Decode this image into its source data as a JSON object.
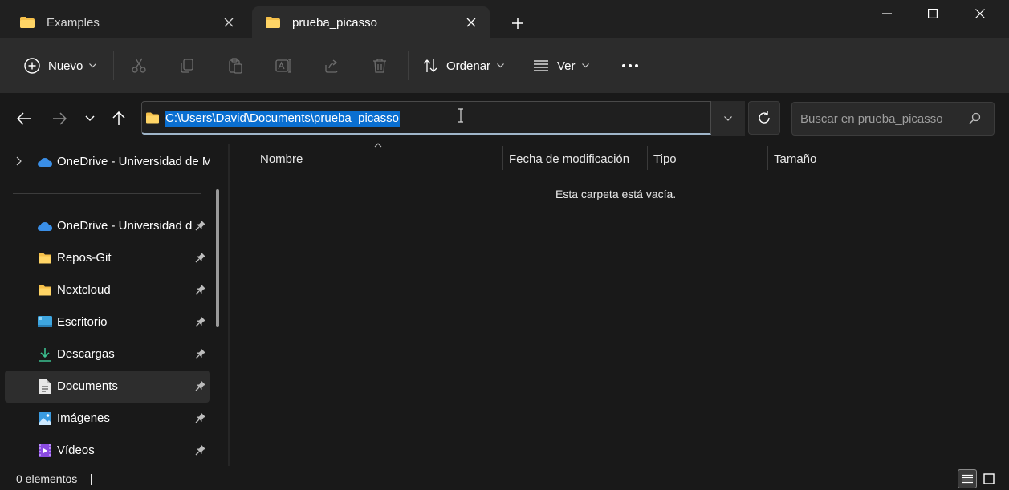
{
  "tabs": [
    {
      "label": "Examples",
      "active": false
    },
    {
      "label": "prueba_picasso",
      "active": true
    }
  ],
  "toolbar": {
    "new_label": "Nuevo",
    "sort_label": "Ordenar",
    "view_label": "Ver"
  },
  "address": {
    "path": "C:\\Users\\David\\Documents\\prueba_picasso"
  },
  "search": {
    "placeholder": "Buscar en prueba_picasso"
  },
  "sidebar": {
    "top_item": "OneDrive - Universidad de M",
    "items": [
      {
        "label": "OneDrive - Universidad de Málaga",
        "icon": "cloud-icon"
      },
      {
        "label": "Repos-Git",
        "icon": "folder-icon"
      },
      {
        "label": "Nextcloud",
        "icon": "folder-icon"
      },
      {
        "label": "Escritorio",
        "icon": "desktop-icon"
      },
      {
        "label": "Descargas",
        "icon": "download-icon"
      },
      {
        "label": "Documents",
        "icon": "document-icon",
        "selected": true
      },
      {
        "label": "Imágenes",
        "icon": "image-icon"
      },
      {
        "label": "Vídeos",
        "icon": "video-icon"
      }
    ]
  },
  "columns": {
    "name": "Nombre",
    "modified": "Fecha de modificación",
    "type": "Tipo",
    "size": "Tamaño"
  },
  "content": {
    "empty_message": "Esta carpeta está vacía."
  },
  "status": {
    "items_text": "0 elementos"
  },
  "colors": {
    "accent": "#0a6fd1",
    "folder": "#f5c04a",
    "onedrive": "#3a8ee6"
  }
}
